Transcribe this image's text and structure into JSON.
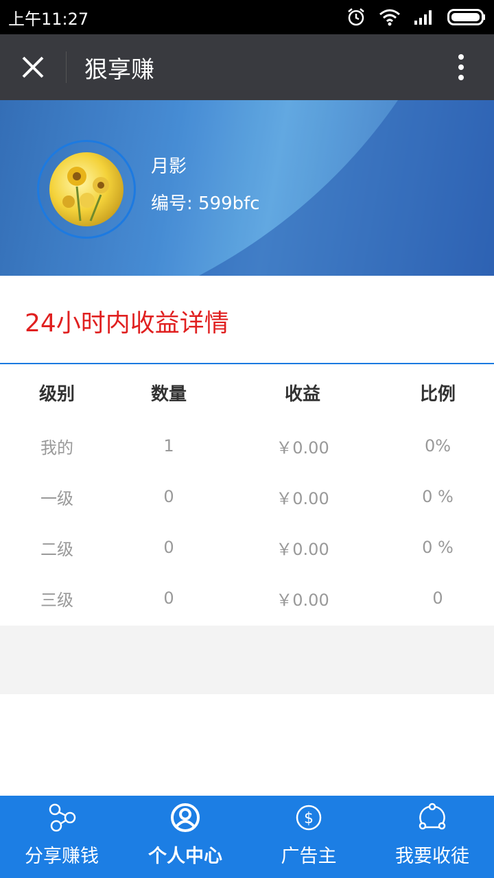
{
  "status_bar": {
    "time": "上午11:27",
    "icons": [
      "alarm-icon",
      "wifi-icon",
      "signal-icon",
      "battery-icon"
    ]
  },
  "title_bar": {
    "title": "狠享赚",
    "close_icon": "close-icon",
    "more_icon": "more-vertical-icon"
  },
  "profile": {
    "name": "月影",
    "id_text": "编号: 599bfc"
  },
  "section": {
    "title": "24小时内收益详情"
  },
  "table": {
    "headers": [
      "级别",
      "数量",
      "收益",
      "比例"
    ],
    "rows": [
      [
        "我的",
        "1",
        "￥0.00",
        "0%"
      ],
      [
        "一级",
        "0",
        "￥0.00",
        "0 %"
      ],
      [
        "二级",
        "0",
        "￥0.00",
        "0 %"
      ],
      [
        "三级",
        "0",
        "￥0.00",
        "0"
      ]
    ]
  },
  "bottom_nav": {
    "items": [
      {
        "label": "分享赚钱",
        "icon": "share-network-icon",
        "active": false
      },
      {
        "label": "个人中心",
        "icon": "user-circle-icon",
        "active": true
      },
      {
        "label": "广告主",
        "icon": "dollar-circle-icon",
        "active": false
      },
      {
        "label": "我要收徒",
        "icon": "share-circle-icon",
        "active": false
      }
    ]
  },
  "colors": {
    "title_bar_bg": "#393a3f",
    "accent_blue": "#1c7ee4",
    "section_title_red": "#e02020"
  }
}
